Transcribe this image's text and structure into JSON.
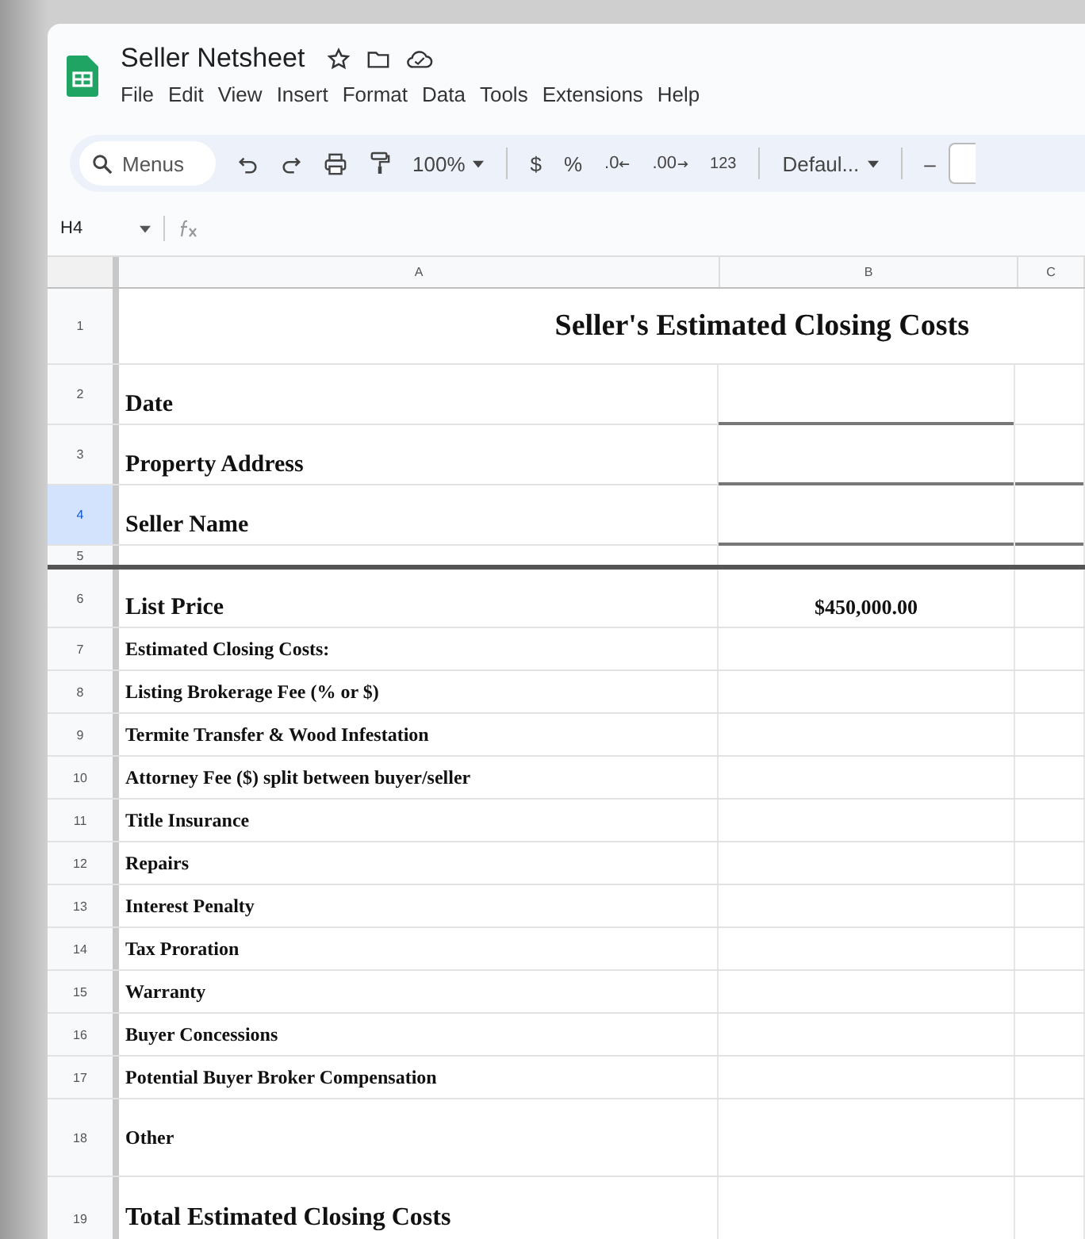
{
  "document": {
    "title": "Seller Netsheet"
  },
  "menu": [
    "File",
    "Edit",
    "View",
    "Insert",
    "Format",
    "Data",
    "Tools",
    "Extensions",
    "Help"
  ],
  "toolbar": {
    "search_placeholder": "Menus",
    "zoom": "100%",
    "currency": "$",
    "percent": "%",
    "decrease_decimals": ".0",
    "increase_decimals": ".00",
    "number_format": "123",
    "font": "Defaul...",
    "font_size_minus": "–"
  },
  "formula_bar": {
    "cell_reference": "H4"
  },
  "columns": [
    {
      "label": "A",
      "selected": false
    },
    {
      "label": "B",
      "selected": false
    },
    {
      "label": "C",
      "selected": false
    }
  ],
  "rows": [
    {
      "number": "1",
      "kind": "title",
      "label": "Seller's Estimated Closing Costs",
      "selected": false
    },
    {
      "number": "2",
      "kind": "field",
      "label": "Date",
      "selected": false
    },
    {
      "number": "3",
      "kind": "field",
      "label": "Property Address",
      "selected": false
    },
    {
      "number": "4",
      "kind": "field",
      "label": "Seller Name",
      "selected": true
    },
    {
      "number": "5",
      "kind": "spacer",
      "label": "",
      "selected": false
    },
    {
      "number": "6",
      "kind": "price",
      "label": "List Price",
      "value": "$450,000.00",
      "selected": false
    },
    {
      "number": "7",
      "kind": "item",
      "label": "Estimated Closing Costs:",
      "selected": false
    },
    {
      "number": "8",
      "kind": "item",
      "label": "Listing Brokerage Fee (% or $)",
      "selected": false
    },
    {
      "number": "9",
      "kind": "item",
      "label": "Termite Transfer & Wood Infestation",
      "selected": false
    },
    {
      "number": "10",
      "kind": "item",
      "label": "Attorney Fee ($) split between buyer/seller",
      "selected": false
    },
    {
      "number": "11",
      "kind": "item",
      "label": "Title Insurance",
      "selected": false
    },
    {
      "number": "12",
      "kind": "item",
      "label": "Repairs",
      "selected": false
    },
    {
      "number": "13",
      "kind": "item",
      "label": "Interest Penalty",
      "selected": false
    },
    {
      "number": "14",
      "kind": "item",
      "label": "Tax Proration",
      "selected": false
    },
    {
      "number": "15",
      "kind": "item",
      "label": "Warranty",
      "selected": false
    },
    {
      "number": "16",
      "kind": "item",
      "label": "Buyer Concessions",
      "selected": false
    },
    {
      "number": "17",
      "kind": "item",
      "label": "Potential Buyer Broker Compensation",
      "selected": false
    },
    {
      "number": "18",
      "kind": "tall",
      "label": "Other",
      "selected": false
    },
    {
      "number": "19",
      "kind": "total",
      "label": "Total Estimated Closing Costs",
      "selected": false
    }
  ]
}
